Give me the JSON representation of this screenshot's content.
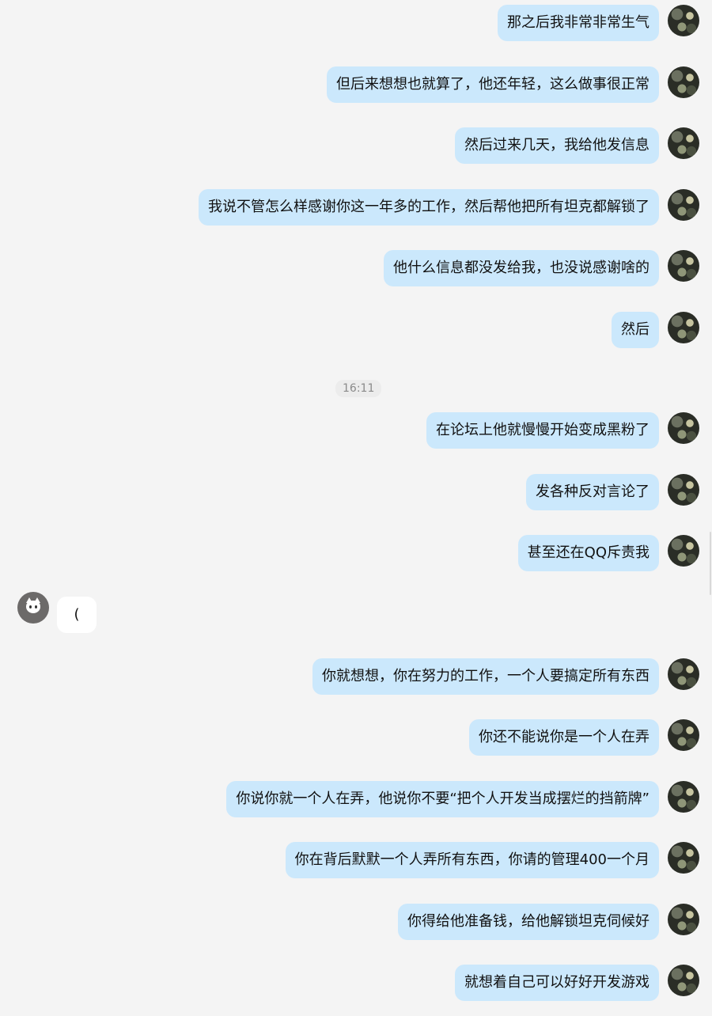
{
  "timestamp": "16:11",
  "messages": [
    {
      "side": "right",
      "text": "那之后我非常非常生气"
    },
    {
      "side": "right",
      "text": "但后来想想也就算了，他还年轻，这么做事很正常"
    },
    {
      "side": "right",
      "text": "然后过来几天，我给他发信息"
    },
    {
      "side": "right",
      "text": "我说不管怎么样感谢你这一年多的工作，然后帮他把所有坦克都解锁了"
    },
    {
      "side": "right",
      "text": "他什么信息都没发给我，也没说感谢啥的"
    },
    {
      "side": "right",
      "text": "然后"
    },
    {
      "side": "right",
      "text": "在论坛上他就慢慢开始变成黑粉了"
    },
    {
      "side": "right",
      "text": "发各种反对言论了"
    },
    {
      "side": "right",
      "text": "甚至还在QQ斥责我"
    },
    {
      "side": "left",
      "text": "("
    },
    {
      "side": "right",
      "text": "你就想想，你在努力的工作，一个人要搞定所有东西"
    },
    {
      "side": "right",
      "text": "你还不能说你是一个人在弄"
    },
    {
      "side": "right",
      "text": "你说你就一个人在弄，他说你不要“把个人开发当成摆烂的挡箭牌”"
    },
    {
      "side": "right",
      "text": "你在背后默默一个人弄所有东西，你请的管理400一个月"
    },
    {
      "side": "right",
      "text": "你得给他准备钱，给他解锁坦克伺候好"
    },
    {
      "side": "right",
      "text": "就想着自己可以好好开发游戏"
    }
  ],
  "icons": {
    "self_avatar": "camouflage-avatar-icon",
    "other_avatar": "white-cat-avatar-icon"
  },
  "colors": {
    "background": "#f4f4f4",
    "self_bubble": "#cbe8fc",
    "other_bubble": "#ffffff",
    "timestamp_text": "#8a8a8a"
  }
}
